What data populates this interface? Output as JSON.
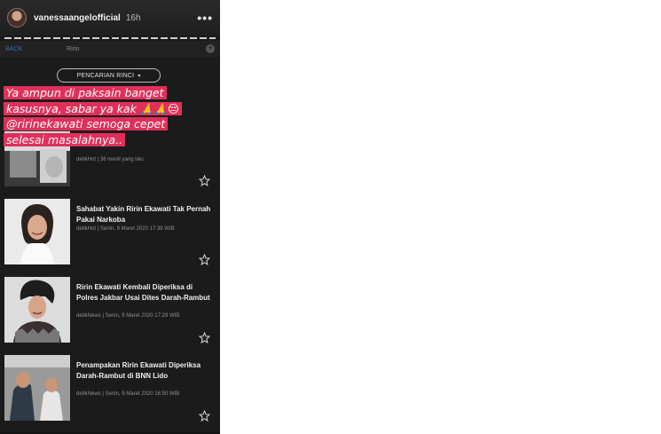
{
  "story": {
    "username": "vanessaangelofficial",
    "time": "16h",
    "more_icon": "•••"
  },
  "background_app": {
    "back_label": "BACK",
    "search_text": "Ririn",
    "filter_label": "PENCARIAN RINCI",
    "filter_caret": "▾"
  },
  "caption": {
    "lines": [
      "Ya ampun di paksain banget",
      "kasusnya, sabar ya kak 🙏🙏😔",
      "@ririnekawati semoga cepet",
      "selesai masalahnya.."
    ]
  },
  "news": [
    {
      "title": "",
      "meta": "detikHot | 36 menit yang lalu"
    },
    {
      "title": "Sahabat Yakin Ririn Ekawati Tak Pernah Pakai Narkoba",
      "meta": "detikHot | Senin, 9 Maret 2020 17:38 WIB"
    },
    {
      "title": "Ririn Ekawati Kembali Diperiksa di Polres Jakbar Usai Dites Darah-Rambut",
      "meta": "detikNews | Senin, 9 Maret 2020 17:29 WIB"
    },
    {
      "title": "Penampakan Ririn Ekawati Diperiksa Darah-Rambut di BNN Lido",
      "meta": "detikNews | Senin, 9 Maret 2020 16:50 WIB"
    }
  ],
  "colors": {
    "caption_highlight": "#e0305a",
    "background": "#1b1b1b"
  },
  "icons": [
    "avatar",
    "more-icon",
    "chevron-down-icon",
    "star-icon"
  ]
}
